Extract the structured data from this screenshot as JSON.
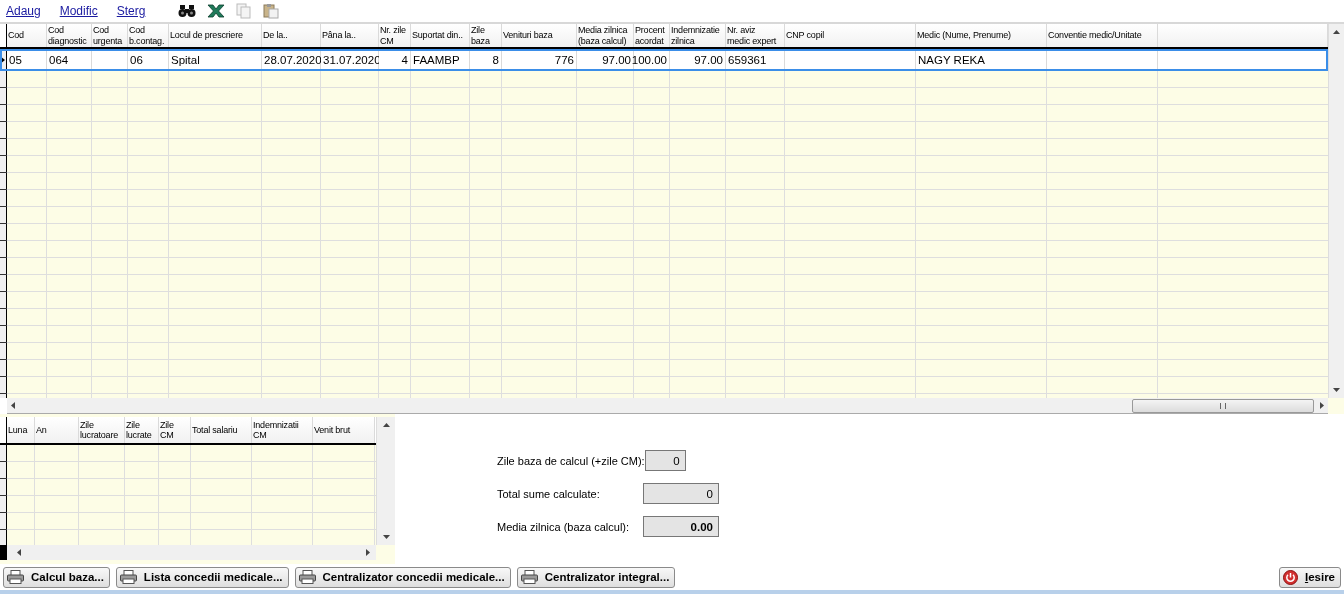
{
  "toolbar": {
    "links": [
      "Adaug",
      "Modific",
      "Sterg"
    ],
    "tools": [
      {
        "kind": "find",
        "disabled": false
      },
      {
        "kind": "excel",
        "disabled": false
      },
      {
        "kind": "copy",
        "disabled": true
      },
      {
        "kind": "paste",
        "disabled": true
      }
    ]
  },
  "main_grid": {
    "columns": [
      {
        "label": "Cod",
        "numeric": false
      },
      {
        "label": "Cod\ndiagnostic",
        "numeric": false
      },
      {
        "label": "Cod\nurgenta"
      },
      {
        "label": "Cod\nb.contag.",
        "numeric": false
      },
      {
        "label": "Locul de prescriere",
        "numeric": false
      },
      {
        "label": "De la..",
        "numeric": false
      },
      {
        "label": "Pâna la..",
        "numeric": false
      },
      {
        "label": "Nr. zile\nCM",
        "numeric": true
      },
      {
        "label": "Suportat din..",
        "numeric": false
      },
      {
        "label": "Zile\nbaza",
        "numeric": true
      },
      {
        "label": "Venituri baza",
        "numeric": true
      },
      {
        "label": "Media zilnica\n(baza calcul)",
        "numeric": true
      },
      {
        "label": "Procent\nacordat",
        "numeric": true
      },
      {
        "label": "Indemnizatie\nzilnica",
        "numeric": true
      },
      {
        "label": "Nr. aviz\nmedic expert",
        "numeric": false
      },
      {
        "label": "CNP copil"
      },
      {
        "label": "Medic (Nume, Prenume)",
        "numeric": false
      },
      {
        "label": "Conventie medic/Unitate"
      }
    ],
    "rows": [
      {
        "selected": true,
        "cells": [
          "05",
          "064",
          "",
          "06",
          "Spital",
          "28.07.2020",
          "31.07.2020",
          "4",
          "FAAMBP",
          "8",
          "776",
          "97.00",
          "100.00",
          "97.00",
          "659361",
          "",
          "NAGY REKA",
          ""
        ]
      }
    ]
  },
  "calc_grid": {
    "columns": [
      {
        "label": "Luna"
      },
      {
        "label": "An"
      },
      {
        "label": "Zile\nlucratoare"
      },
      {
        "label": "Zile\nlucrate"
      },
      {
        "label": "Zile\nCM"
      },
      {
        "label": "Total salariu"
      },
      {
        "label": "Indemnizatii\nCM"
      },
      {
        "label": "Venit brut"
      }
    ]
  },
  "summary": [
    {
      "label": "Zile baza de calcul (+zile CM):",
      "value": "0",
      "bold": false,
      "wide": false
    },
    {
      "label": "Total sume calculate:",
      "value": "0",
      "bold": false,
      "wide": true
    },
    {
      "label": "Media zilnica (baza calcul):",
      "value": "0.00",
      "bold": true,
      "wide": true
    }
  ],
  "buttons": [
    {
      "label": "Calcul baza...",
      "kind": "print"
    },
    {
      "label": "Lista concedii medicale...",
      "kind": "print"
    },
    {
      "label": "Centralizator concedii medicale...",
      "kind": "print"
    },
    {
      "label": "Centralizator integral...",
      "kind": "print"
    },
    {
      "label": "Iesire",
      "kind": "exit"
    }
  ]
}
